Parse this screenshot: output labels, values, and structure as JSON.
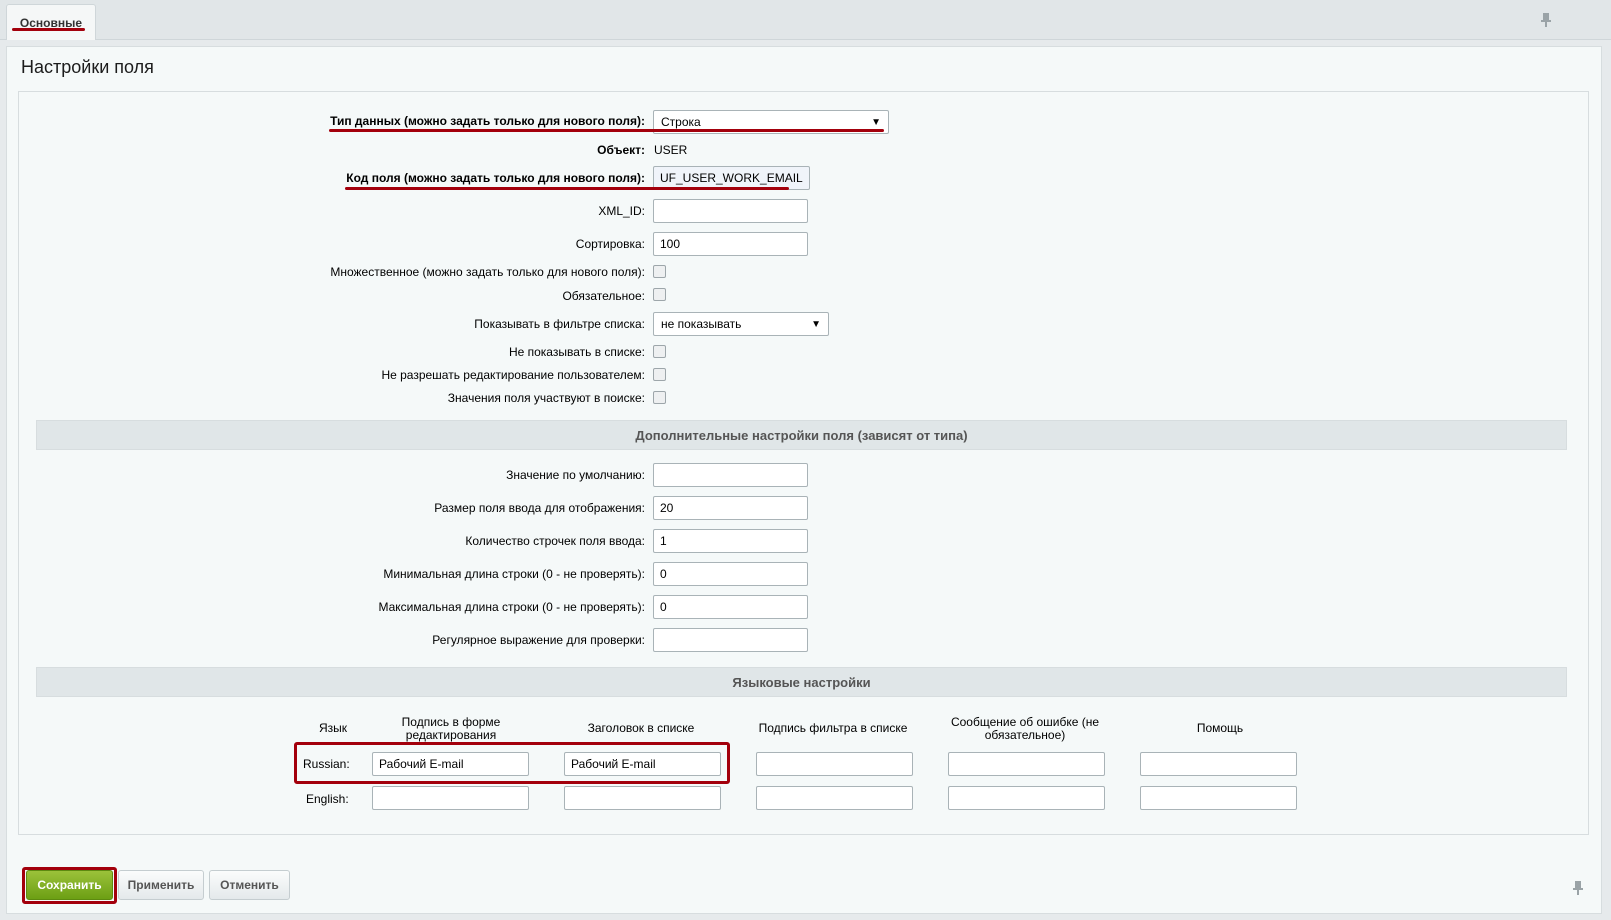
{
  "tabs": [
    {
      "label": "Основные"
    }
  ],
  "page_title": "Настройки поля",
  "fields": {
    "data_type": {
      "label": "Тип данных (можно задать только для нового поля):",
      "value": "Строка"
    },
    "object": {
      "label": "Объект:",
      "value": "USER"
    },
    "field_code": {
      "label": "Код поля (можно задать только для нового поля):",
      "value": "UF_USER_WORK_EMAIL"
    },
    "xml_id": {
      "label": "XML_ID:",
      "value": ""
    },
    "sort": {
      "label": "Сортировка:",
      "value": "100"
    },
    "multiple": {
      "label": "Множественное (можно задать только для нового поля):",
      "checked": false
    },
    "required": {
      "label": "Обязательное:",
      "checked": false
    },
    "show_filter": {
      "label": "Показывать в фильтре списка:",
      "value": "не показывать"
    },
    "hide_in_list": {
      "label": "Не показывать в списке:",
      "checked": false
    },
    "no_user_edit": {
      "label": "Не разрешать редактирование пользователем:",
      "checked": false
    },
    "searchable": {
      "label": "Значения поля участвуют в поиске:",
      "checked": false
    }
  },
  "extra_section": {
    "title": "Дополнительные настройки поля (зависят от типа)",
    "default_value": {
      "label": "Значение по умолчанию:",
      "value": ""
    },
    "input_size": {
      "label": "Размер поля ввода для отображения:",
      "value": "20"
    },
    "rows": {
      "label": "Количество строчек поля ввода:",
      "value": "1"
    },
    "min_length": {
      "label": "Минимальная длина строки (0 - не проверять):",
      "value": "0"
    },
    "max_length": {
      "label": "Максимальная длина строки (0 - не проверять):",
      "value": "0"
    },
    "regexp": {
      "label": "Регулярное выражение для проверки:",
      "value": ""
    }
  },
  "lang_section": {
    "title": "Языковые настройки",
    "headers": {
      "lang": "Язык",
      "edit_form_label_1": "Подпись в форме",
      "edit_form_label_2": "редактирования",
      "list_column": "Заголовок в списке",
      "filter_label": "Подпись фильтра в списке",
      "error_message_1": "Сообщение об ошибке (не",
      "error_message_2": "обязательное)",
      "help": "Помощь"
    },
    "rows": [
      {
        "lang": "Russian:",
        "edit_form_label": "Рабочий E-mail",
        "list_column": "Рабочий E-mail",
        "filter_label": "",
        "error_message": "",
        "help": ""
      },
      {
        "lang": "English:",
        "edit_form_label": "",
        "list_column": "",
        "filter_label": "",
        "error_message": "",
        "help": ""
      }
    ]
  },
  "buttons": {
    "save": "Сохранить",
    "apply": "Применить",
    "cancel": "Отменить"
  },
  "icons": {
    "pin": "pin-icon",
    "dropdown": "dropdown-arrow-icon"
  },
  "colors": {
    "highlight": "#a3000c",
    "primary_button": "#7aab1f"
  }
}
